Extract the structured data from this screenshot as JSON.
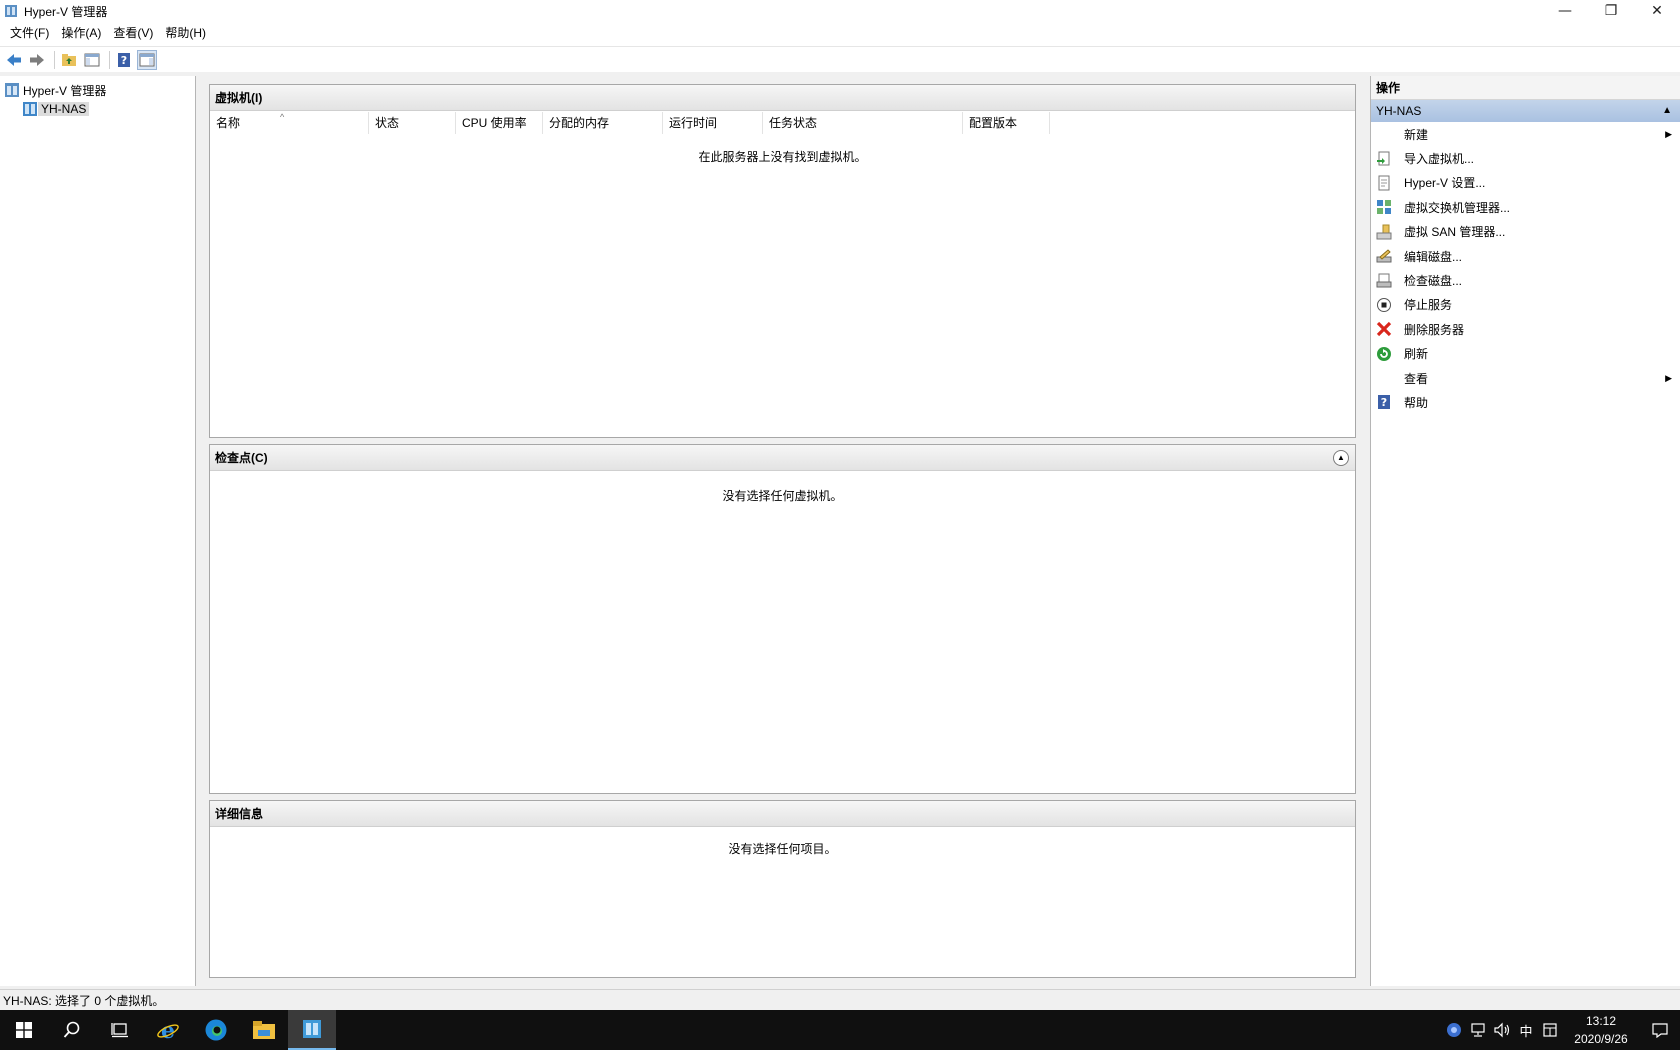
{
  "window": {
    "title": "Hyper-V 管理器",
    "minimize": "—",
    "restore": "❐",
    "close": "✕"
  },
  "menu": [
    "文件(F)",
    "操作(A)",
    "查看(V)",
    "帮助(H)"
  ],
  "tree": {
    "root": "Hyper-V 管理器",
    "server": "YH-NAS"
  },
  "vm_pane": {
    "title": "虚拟机(I)",
    "columns": [
      "名称",
      "状态",
      "CPU 使用率",
      "分配的内存",
      "运行时间",
      "任务状态",
      "配置版本"
    ],
    "empty": "在此服务器上没有找到虚拟机。"
  },
  "checkpoint_pane": {
    "title": "检查点(C)",
    "empty": "没有选择任何虚拟机。"
  },
  "details_pane": {
    "title": "详细信息",
    "empty": "没有选择任何项目。"
  },
  "actions": {
    "title": "操作",
    "group": "YH-NAS",
    "items": [
      {
        "label": "新建",
        "icon": "none",
        "submenu": true
      },
      {
        "label": "导入虚拟机...",
        "icon": "import-vm-icon"
      },
      {
        "label": "Hyper-V 设置...",
        "icon": "settings-doc-icon"
      },
      {
        "label": "虚拟交换机管理器...",
        "icon": "virtual-switch-icon"
      },
      {
        "label": "虚拟 SAN 管理器...",
        "icon": "virtual-san-icon"
      },
      {
        "label": "编辑磁盘...",
        "icon": "edit-disk-icon"
      },
      {
        "label": "检查磁盘...",
        "icon": "inspect-disk-icon"
      },
      {
        "label": "停止服务",
        "icon": "stop-service-icon"
      },
      {
        "label": "删除服务器",
        "icon": "remove-server-icon"
      },
      {
        "label": "刷新",
        "icon": "refresh-icon"
      },
      {
        "label": "查看",
        "icon": "none",
        "submenu": true
      },
      {
        "label": "帮助",
        "icon": "help-icon"
      }
    ]
  },
  "status": "YH-NAS:  选择了 0 个虚拟机。",
  "tray": {
    "ime": "中",
    "time": "13:12",
    "date": "2020/9/26"
  },
  "colors": {
    "selection_header": "#a9c1e1",
    "taskbar": "#101010",
    "remove_red": "#d9261c",
    "refresh_green": "#2e9c3c"
  }
}
